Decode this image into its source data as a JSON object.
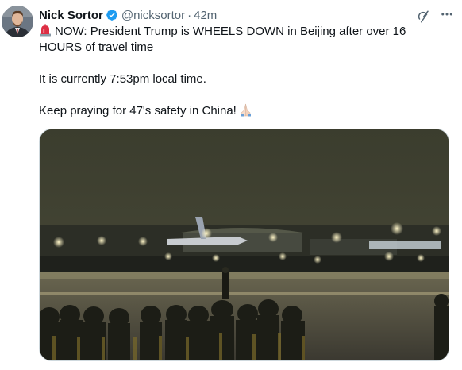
{
  "author": {
    "name": "Nick Sortor",
    "handle": "@nicksortor",
    "separator": "·",
    "time": "42m",
    "verified": true
  },
  "icons": {
    "verified": "verified-badge-icon",
    "grok": "grok-icon",
    "more": "more-icon",
    "siren": "rotating-light-icon",
    "pray": "folded-hands-icon"
  },
  "tweet": {
    "line1": "NOW: President Trump is WHEELS DOWN in Beijing after over 16",
    "line2": "HOURS of travel time",
    "para2": "It is currently 7:53pm local time.",
    "para3": "Keep praying for 47's safety in China!"
  },
  "colors": {
    "text": "#0f1419",
    "secondary": "#536471",
    "verified": "#1d9bf0",
    "border": "#cfd9de"
  }
}
